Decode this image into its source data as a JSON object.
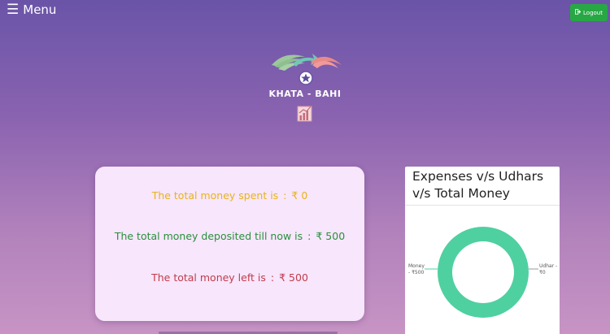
{
  "header": {
    "menu_label": "Menu",
    "logout_label": "Logout"
  },
  "logo": {
    "title": "KHATA - BAHI"
  },
  "summary": {
    "spent_label": "The total money spent is",
    "spent_value": "₹ 0",
    "deposited_label": "The total money deposited till now is",
    "deposited_value": "₹ 500",
    "left_label": "The total money left is",
    "left_value": "₹ 500",
    "separator": ":",
    "colors": {
      "spent": "#e8b418",
      "deposited": "#2a8f3c",
      "left": "#c23c4c"
    }
  },
  "chart_data": {
    "type": "pie",
    "title": "Expenses v/s Udhars v/s Total Money",
    "slices": [
      {
        "name": "Money",
        "value": 500,
        "label_line1": "Money",
        "label_line2": "- ₹500",
        "color": "#4fd0a0"
      },
      {
        "name": "Udhar",
        "value": 0,
        "label_line1": "Udhar -",
        "label_line2": "₹0",
        "color": "#f0c040"
      }
    ],
    "donut": true
  }
}
